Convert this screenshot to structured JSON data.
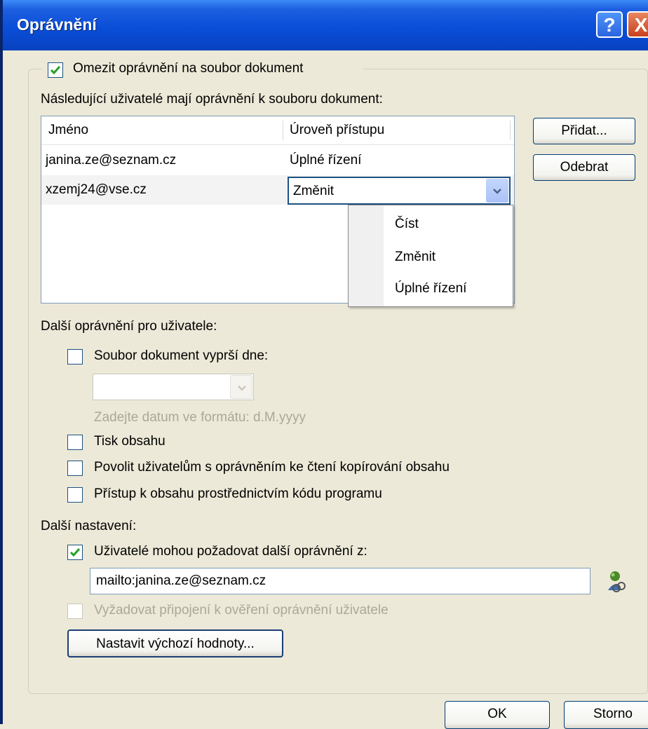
{
  "title": "Oprávnění",
  "titlebar": {
    "help_label": "?",
    "close_label": "X"
  },
  "restrict": {
    "checked": true,
    "label": "Omezit oprávnění na soubor dokument"
  },
  "users_heading": "Následující uživatelé mají oprávnění k souboru dokument:",
  "users_table": {
    "columns": [
      "Jméno",
      "Úroveň přístupu"
    ],
    "rows": [
      {
        "name": "janina.ze@seznam.cz",
        "access": "Úplné řízení"
      },
      {
        "name": "xzemj24@vse.cz",
        "access": "Změnit"
      }
    ]
  },
  "access_dropdown": {
    "options": [
      "Číst",
      "Změnit",
      "Úplné řízení"
    ]
  },
  "buttons": {
    "add": "Přidat...",
    "remove": "Odebrat",
    "defaults": "Nastavit výchozí hodnoty...",
    "ok": "OK",
    "cancel": "Storno"
  },
  "extra_permissions": {
    "heading": "Další oprávnění pro uživatele:",
    "expire": {
      "checked": false,
      "label": "Soubor dokument vyprší dne:"
    },
    "date_hint": "Zadejte datum ve formátu: d.M.yyyy",
    "print": {
      "checked": false,
      "label": "Tisk obsahu"
    },
    "copy": {
      "checked": false,
      "label": "Povolit uživatelům s oprávněním ke čtení kopírování obsahu"
    },
    "program_access": {
      "checked": false,
      "label": "Přístup k obsahu prostřednictvím kódu programu"
    }
  },
  "other_settings": {
    "heading": "Další nastavení:",
    "request": {
      "checked": true,
      "label": "Uživatelé mohou požadovat další oprávnění z:"
    },
    "email": "mailto:janina.ze@seznam.cz",
    "require_connection": {
      "checked": false,
      "disabled": true,
      "label": "Vyžadovat připojení k ověření oprávnění uživatele"
    }
  },
  "icons": {
    "address_book": "address-book-person-icon"
  },
  "colors": {
    "titlebar": "#0A4ED8",
    "dialog_bg": "#ECE9D8",
    "check": "#21A121"
  }
}
